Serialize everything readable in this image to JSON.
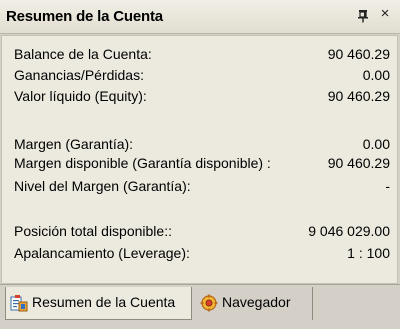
{
  "window": {
    "title": "Resumen de la Cuenta",
    "pin_symbol": "",
    "close_symbol": "×"
  },
  "account": {
    "rows": [
      {
        "label": "Balance de la Cuenta:",
        "value": "90 460.29"
      },
      {
        "label": "Ganancias/Pérdidas:",
        "value": "0.00"
      },
      {
        "label": "Valor líquido (Equity):",
        "value": "90 460.29"
      },
      {
        "label": "Margen (Garantía):",
        "value": "0.00"
      },
      {
        "label": "Margen disponible (Garantía disponible) :",
        "value": "90 460.29"
      },
      {
        "label": "Nivel del Margen (Garantía):",
        "value": "-"
      },
      {
        "label": "Posición total disponible::",
        "value": "9 046 029.00"
      },
      {
        "label": "Apalancamiento (Leverage):",
        "value": "1 : 100"
      }
    ]
  },
  "tabs": [
    {
      "label": "Resumen de la Cuenta",
      "icon": "account-summary-icon",
      "active": true
    },
    {
      "label": "Navegador",
      "icon": "navigator-icon",
      "active": false
    }
  ],
  "colors": {
    "panel_background": "#eceadf",
    "chrome_background": "#d4d0c8"
  }
}
